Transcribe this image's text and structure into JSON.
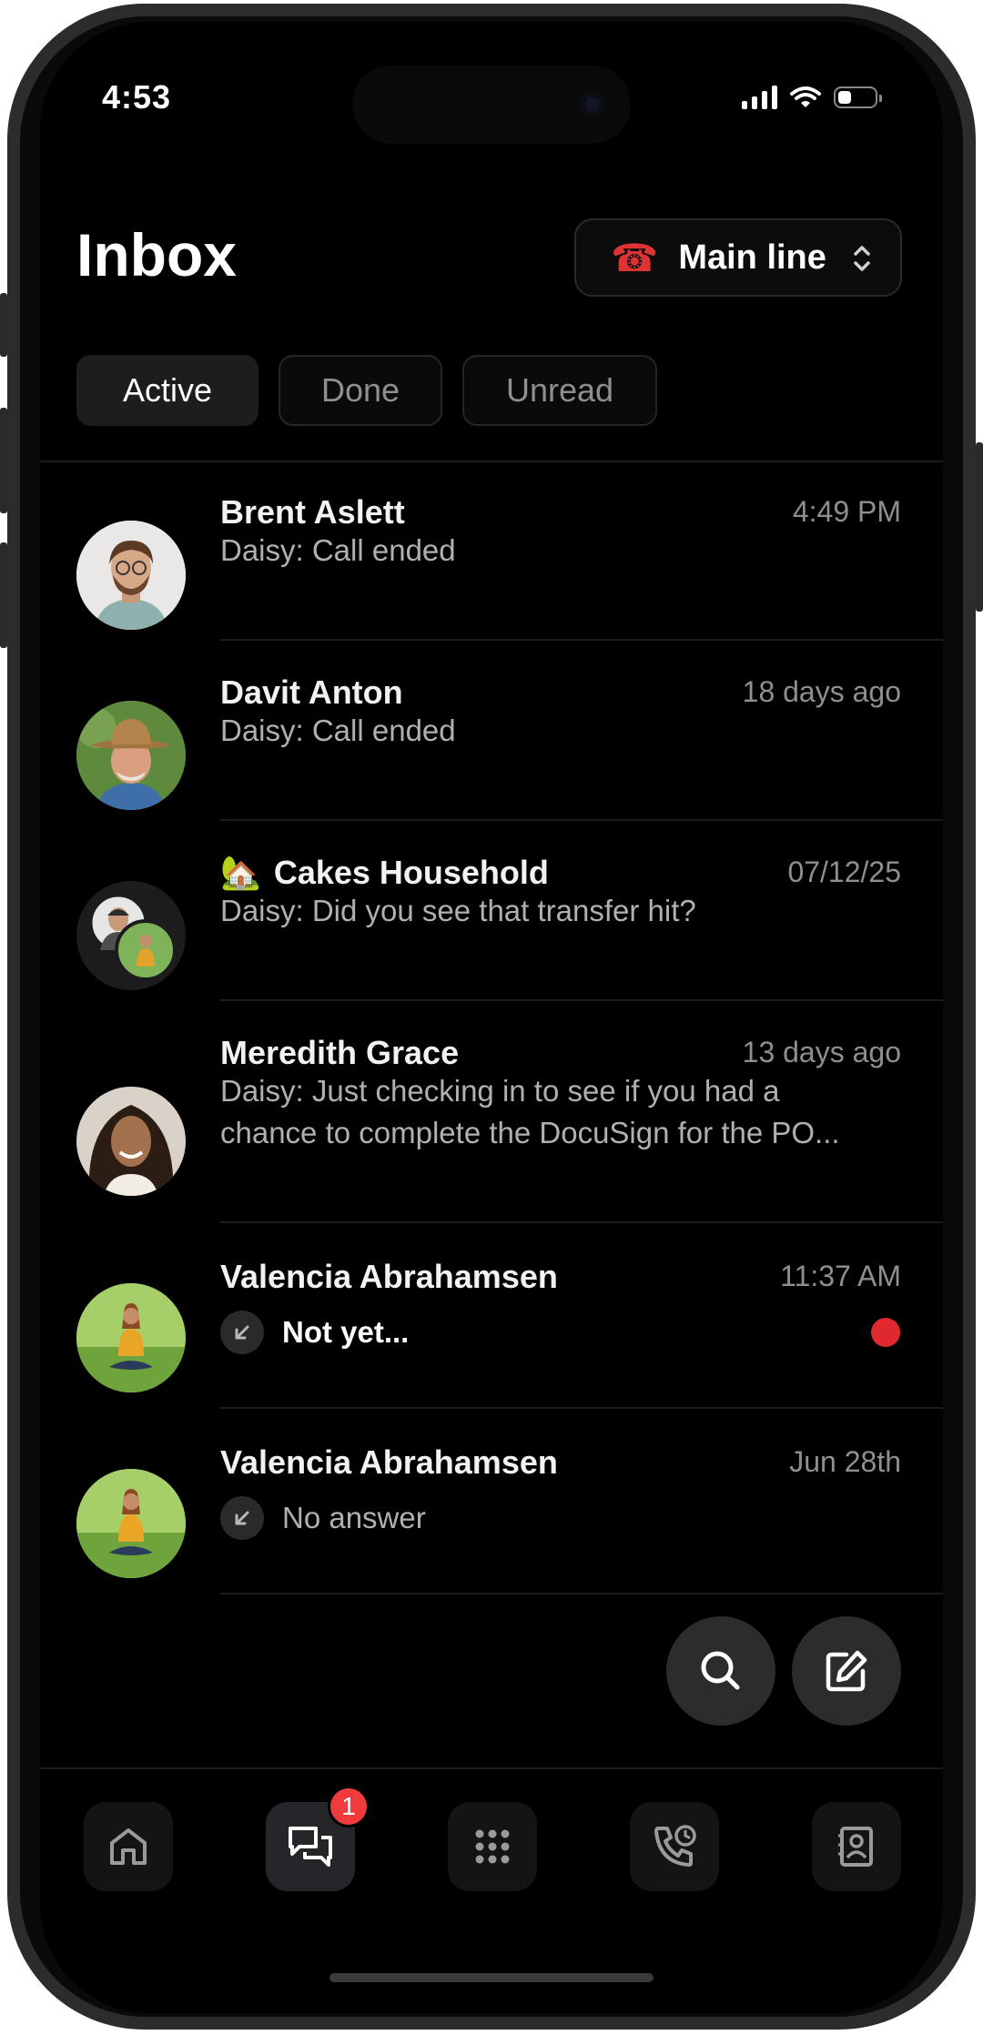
{
  "status_bar": {
    "time": "4:53"
  },
  "header": {
    "title": "Inbox",
    "line_selector": {
      "icon": "telephone-icon",
      "label": "Main line"
    }
  },
  "tabs": [
    {
      "label": "Active",
      "selected": true
    },
    {
      "label": "Done",
      "selected": false
    },
    {
      "label": "Unread",
      "selected": false
    }
  ],
  "conversations": [
    {
      "name": "Brent Aslett",
      "time": "4:49 PM",
      "preview": "Daisy: Call ended"
    },
    {
      "name": "Davit Anton",
      "time": "18 days ago",
      "preview": "Daisy: Call ended"
    },
    {
      "emoji": "🏡",
      "name": "Cakes Household",
      "time": "07/12/25",
      "preview": "Daisy: Did you see that transfer hit?"
    },
    {
      "name": "Meredith Grace",
      "time": "13 days ago",
      "preview_line1": "Daisy: Just checking in to see if you had a",
      "preview_line2": "chance to complete the DocuSign for the PO..."
    },
    {
      "name": "Valencia Abrahamsen",
      "time": "11:37 AM",
      "preview": "Not yet...",
      "unread": true,
      "icon": "incoming-call-icon"
    },
    {
      "name": "Valencia Abrahamsen",
      "time": "Jun 28th",
      "preview": "No answer",
      "unread": false,
      "icon": "incoming-call-icon"
    }
  ],
  "fabs": {
    "search": "search-icon",
    "compose": "compose-icon"
  },
  "bottom_nav": {
    "items": [
      "home-icon",
      "messages-icon",
      "keypad-icon",
      "call-history-icon",
      "contacts-icon"
    ],
    "messages_badge": "1"
  },
  "colors": {
    "background": "#000000",
    "unread_dot": "#e0292e",
    "badge": "#ef3b3b"
  }
}
